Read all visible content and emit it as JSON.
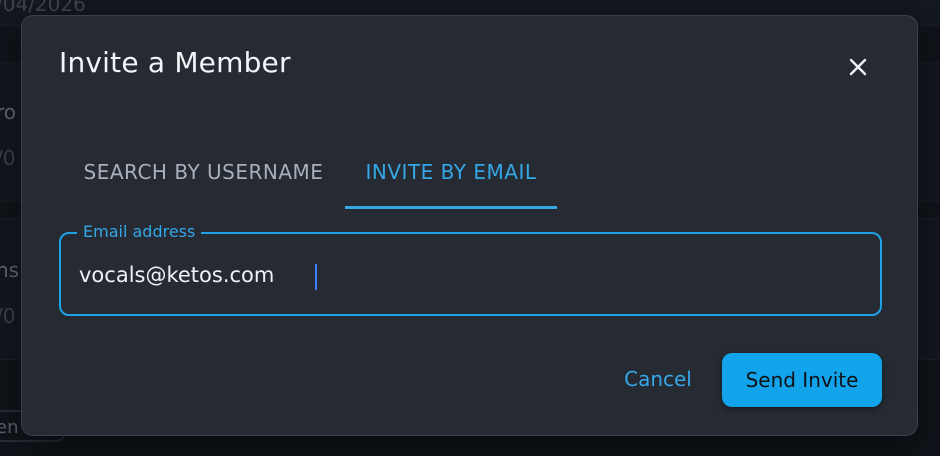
{
  "background": {
    "top_date": "/04/2026",
    "row1_heading": "ro",
    "row1_date": "/0",
    "row2_heading": "ns",
    "row2_date": "/0",
    "pill_text": "en"
  },
  "dialog": {
    "title": "Invite a Member",
    "close_icon": "close-icon",
    "tabs": [
      {
        "label": "SEARCH BY USERNAME",
        "active": false
      },
      {
        "label": "INVITE BY EMAIL",
        "active": true
      }
    ],
    "email_field": {
      "label": "Email address",
      "value": "vocals@ketos.com"
    },
    "actions": {
      "cancel_label": "Cancel",
      "send_label": "Send Invite"
    }
  },
  "colors": {
    "accent": "#35a7e6",
    "primary_button": "#12a4ea",
    "dialog_bg": "#252a33",
    "page_bg": "#15191f"
  }
}
